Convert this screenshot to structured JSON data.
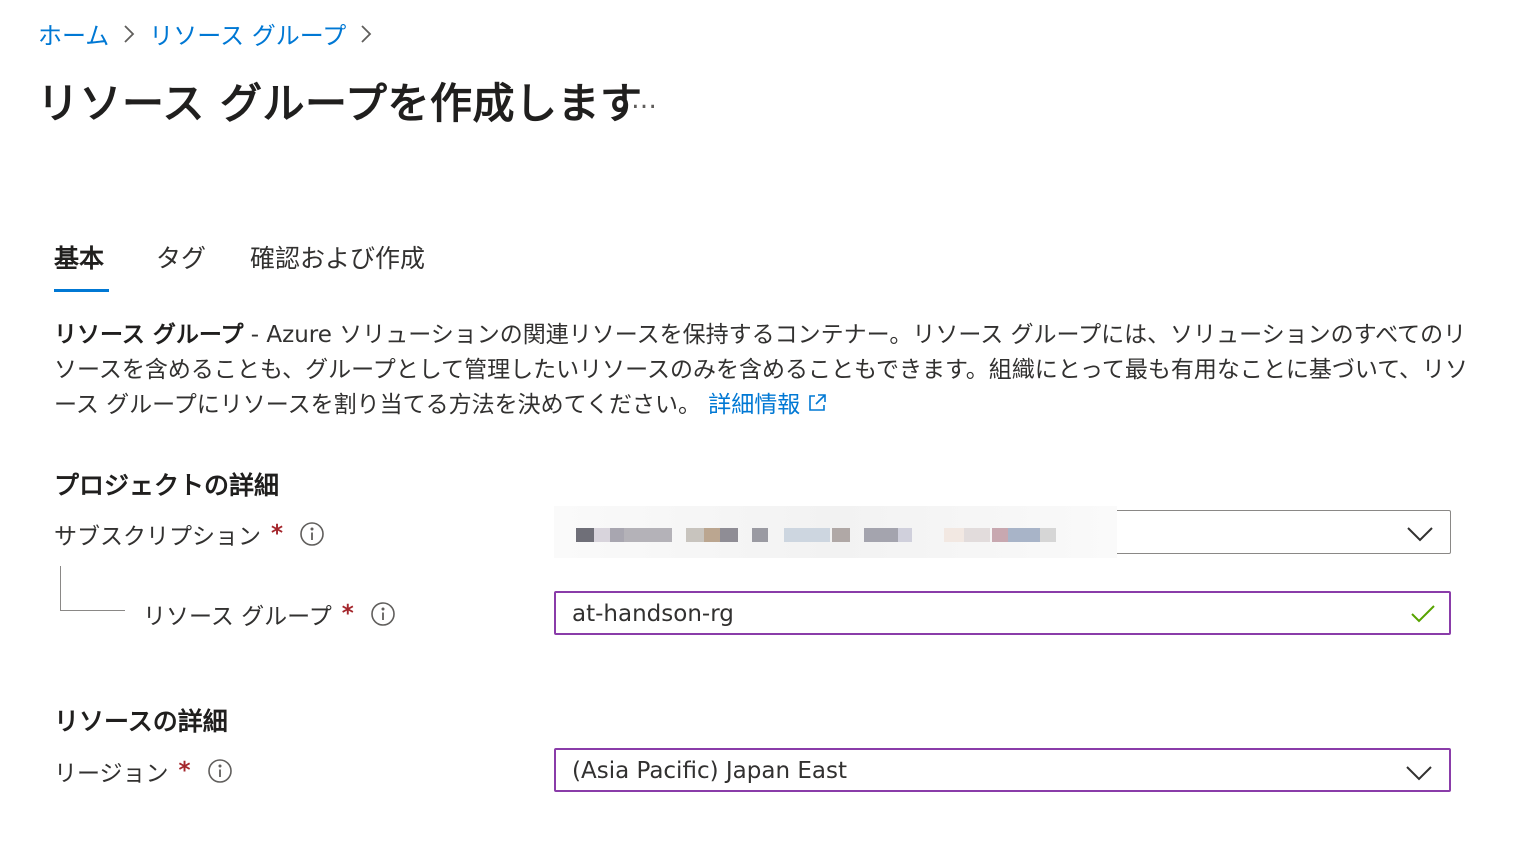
{
  "breadcrumb": {
    "items": [
      "ホーム",
      "リソース グループ"
    ]
  },
  "header": {
    "title": "リソース グループを作成します",
    "more_label": "…"
  },
  "tabs": [
    "基本",
    "タグ",
    "確認および作成"
  ],
  "description": {
    "term": "リソース グループ",
    "text": " - Azure ソリューションの関連リソースを保持するコンテナー。リソース グループには、ソリューションのすべてのリソースを含めることも、グループとして管理したいリソースのみを含めることもできます。組織にとって最も有用なことに基づいて、リソース グループにリソースを割り当てる方法を決めてください。",
    "learn_more": "詳細情報"
  },
  "project_details": {
    "heading": "プロジェクトの詳細",
    "subscription_label": "サブスクリプション",
    "resource_group_label": "リソース グループ",
    "resource_group_value": "at-handson-rg",
    "required_mark": "*"
  },
  "resource_details": {
    "heading": "リソースの詳細",
    "region_label": "リージョン",
    "region_value": "(Asia Pacific) Japan East",
    "required_mark": "*"
  },
  "colors": {
    "link": "#0078d4",
    "focus_border": "#8a3ca9",
    "required": "#a4262c",
    "valid_check": "#57a300"
  },
  "icons": {
    "breadcrumb_separator": "chevron-right-icon",
    "info": "info-icon",
    "external_link": "external-link-icon",
    "dropdown": "chevron-down-icon",
    "valid": "checkmark-icon"
  }
}
